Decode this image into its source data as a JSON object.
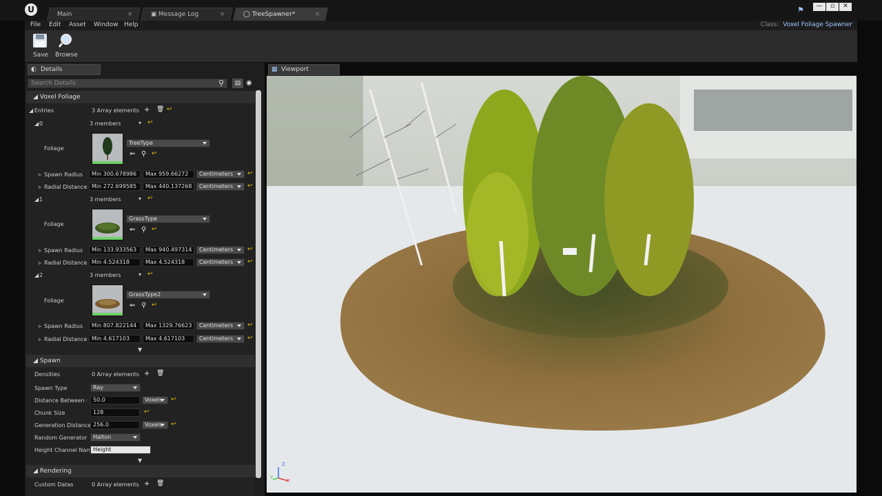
{
  "tabs": [
    {
      "label": "Main"
    },
    {
      "label": "Message Log"
    },
    {
      "label": "TreeSpawner*"
    }
  ],
  "menu": [
    "File",
    "Edit",
    "Asset",
    "Window",
    "Help"
  ],
  "class_label": {
    "prefix": "Class:",
    "value": "Voxel Foliage Spawner"
  },
  "toolbar": {
    "save": "Save",
    "browse": "Browse"
  },
  "details": {
    "tab": "Details",
    "search_placeholder": "Search Details",
    "voxel_foliage": {
      "header": "Voxel Foliage",
      "entries_label": "Entries",
      "entries_value": "3 Array elements",
      "items": [
        {
          "index": "0",
          "members": "3 members",
          "foliage_label": "Foliage",
          "foliage_type": "TreeType",
          "spawn_radius_label": "Spawn Radius",
          "spawn_min": "Min  300.678986",
          "spawn_max": "Max  959.66272",
          "spawn_unit": "Centimeters",
          "radial_label": "Radial Distance",
          "radial_min": "Min  272.699585",
          "radial_max": "Max  440.137268",
          "radial_unit": "Centimeters"
        },
        {
          "index": "1",
          "members": "3 members",
          "foliage_label": "Foliage",
          "foliage_type": "GrassType",
          "spawn_radius_label": "Spawn Radius",
          "spawn_min": "Min  133.933563",
          "spawn_max": "Max  940.497314",
          "spawn_unit": "Centimeters",
          "radial_label": "Radial Distance",
          "radial_min": "Min  4.524318",
          "radial_max": "Max  4.524318",
          "radial_unit": "Centimeters"
        },
        {
          "index": "2",
          "members": "3 members",
          "foliage_label": "Foliage",
          "foliage_type": "GrassType2",
          "spawn_radius_label": "Spawn Radius",
          "spawn_min": "Min  807.822144",
          "spawn_max": "Max  1329.76623",
          "spawn_unit": "Centimeters",
          "radial_label": "Radial Distance",
          "radial_min": "Min  4.617103",
          "radial_max": "Max  4.617103",
          "radial_unit": "Centimeters"
        }
      ]
    },
    "spawn": {
      "header": "Spawn",
      "densities_label": "Densities",
      "densities_value": "0 Array elements",
      "spawn_type_label": "Spawn Type",
      "spawn_type_value": "Ray",
      "distance_label": "Distance Between Clu",
      "distance_value": "50.0",
      "distance_unit": "Voxels",
      "chunk_label": "Chunk Size",
      "chunk_value": "128",
      "generation_label": "Generation Distance",
      "generation_value": "256.0",
      "generation_unit": "Voxels",
      "random_label": "Random Generator",
      "random_value": "Halton",
      "height_label": "Height Channel Name",
      "height_value": "Height"
    },
    "rendering": {
      "header": "Rendering",
      "custom_label": "Custom Datas",
      "custom_value": "0 Array elements"
    }
  },
  "viewport": {
    "tab": "Viewport",
    "axis_x": "X",
    "axis_y": "Y",
    "axis_z": "Z"
  },
  "colors": {
    "accent_text": "#9ec6ff",
    "highlight_yellow": "#e5c100"
  }
}
